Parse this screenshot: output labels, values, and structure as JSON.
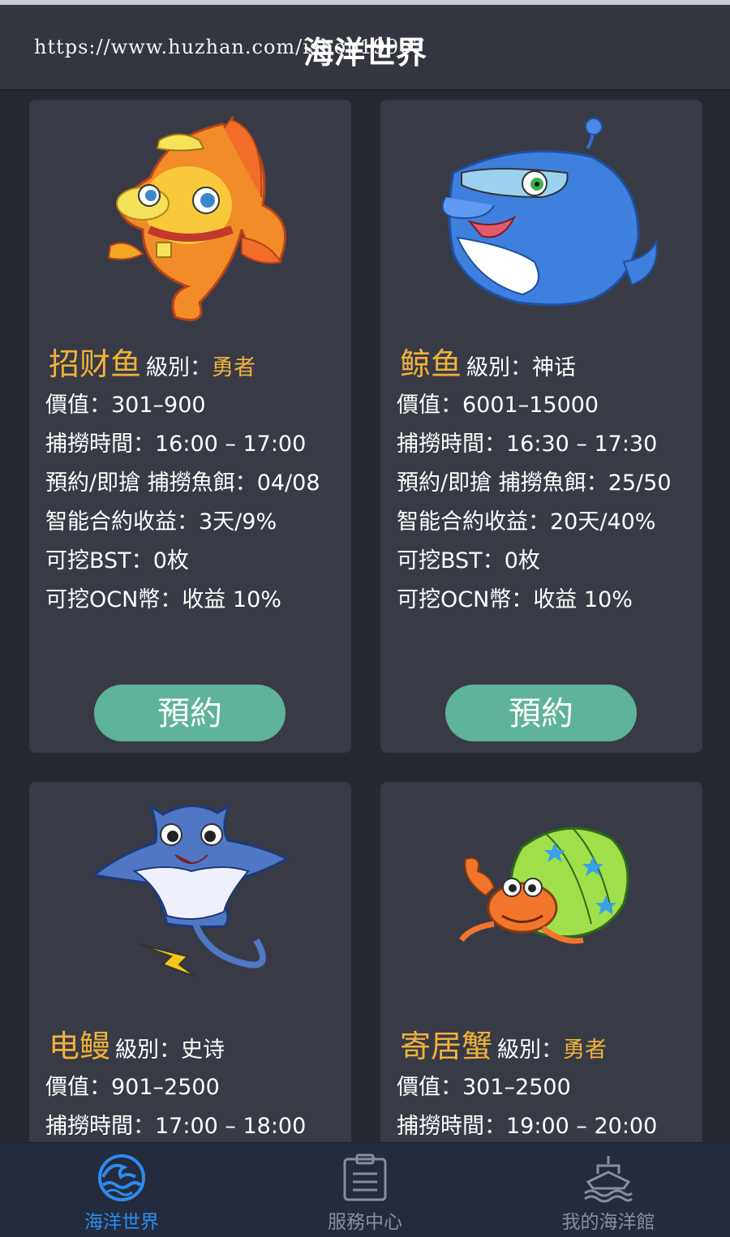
{
  "header": {
    "title": "海洋世界",
    "watermark": "https://www.huzhan.com/ishop19967"
  },
  "labels": {
    "level": "級別：",
    "value": "價值：",
    "time": "捕撈時間：",
    "bait": "預約/即搶 捕撈魚餌：",
    "contract": "智能合約收益：",
    "bst": "可挖BST：",
    "ocn": "可挖OCN幣："
  },
  "cards": [
    {
      "name": "招财鱼",
      "level": "勇者",
      "level_color": "#f0b13c",
      "value": "301–900",
      "time": "16:00 – 17:00",
      "bait": "04/08",
      "contract": "3天/9%",
      "bst": "0枚",
      "ocn": "收益 10%",
      "button": "預約",
      "icon": "goldfish-icon"
    },
    {
      "name": "鲸鱼",
      "level": "神话",
      "level_color": "#ffffff",
      "value": "6001–15000",
      "time": "16:30 – 17:30",
      "bait": "25/50",
      "contract": "20天/40%",
      "bst": "0枚",
      "ocn": "收益 10%",
      "button": "預約",
      "icon": "whale-icon"
    },
    {
      "name": "电鳗",
      "level": "史诗",
      "level_color": "#ffffff",
      "value": "901–2500",
      "time": "17:00 – 18:00",
      "icon": "manta-ray-icon"
    },
    {
      "name": "寄居蟹",
      "level": "勇者",
      "level_color": "#f0b13c",
      "value": "301–2500",
      "time": "19:00 – 20:00",
      "icon": "hermit-crab-icon"
    }
  ],
  "tabs": [
    {
      "label": "海洋世界",
      "icon": "ocean-wave-icon",
      "active": true,
      "color": "#2d8cf0"
    },
    {
      "label": "服務中心",
      "icon": "clipboard-icon",
      "active": false,
      "color": "#8a8e98"
    },
    {
      "label": "我的海洋館",
      "icon": "ship-icon",
      "active": false,
      "color": "#8a8e98"
    }
  ]
}
